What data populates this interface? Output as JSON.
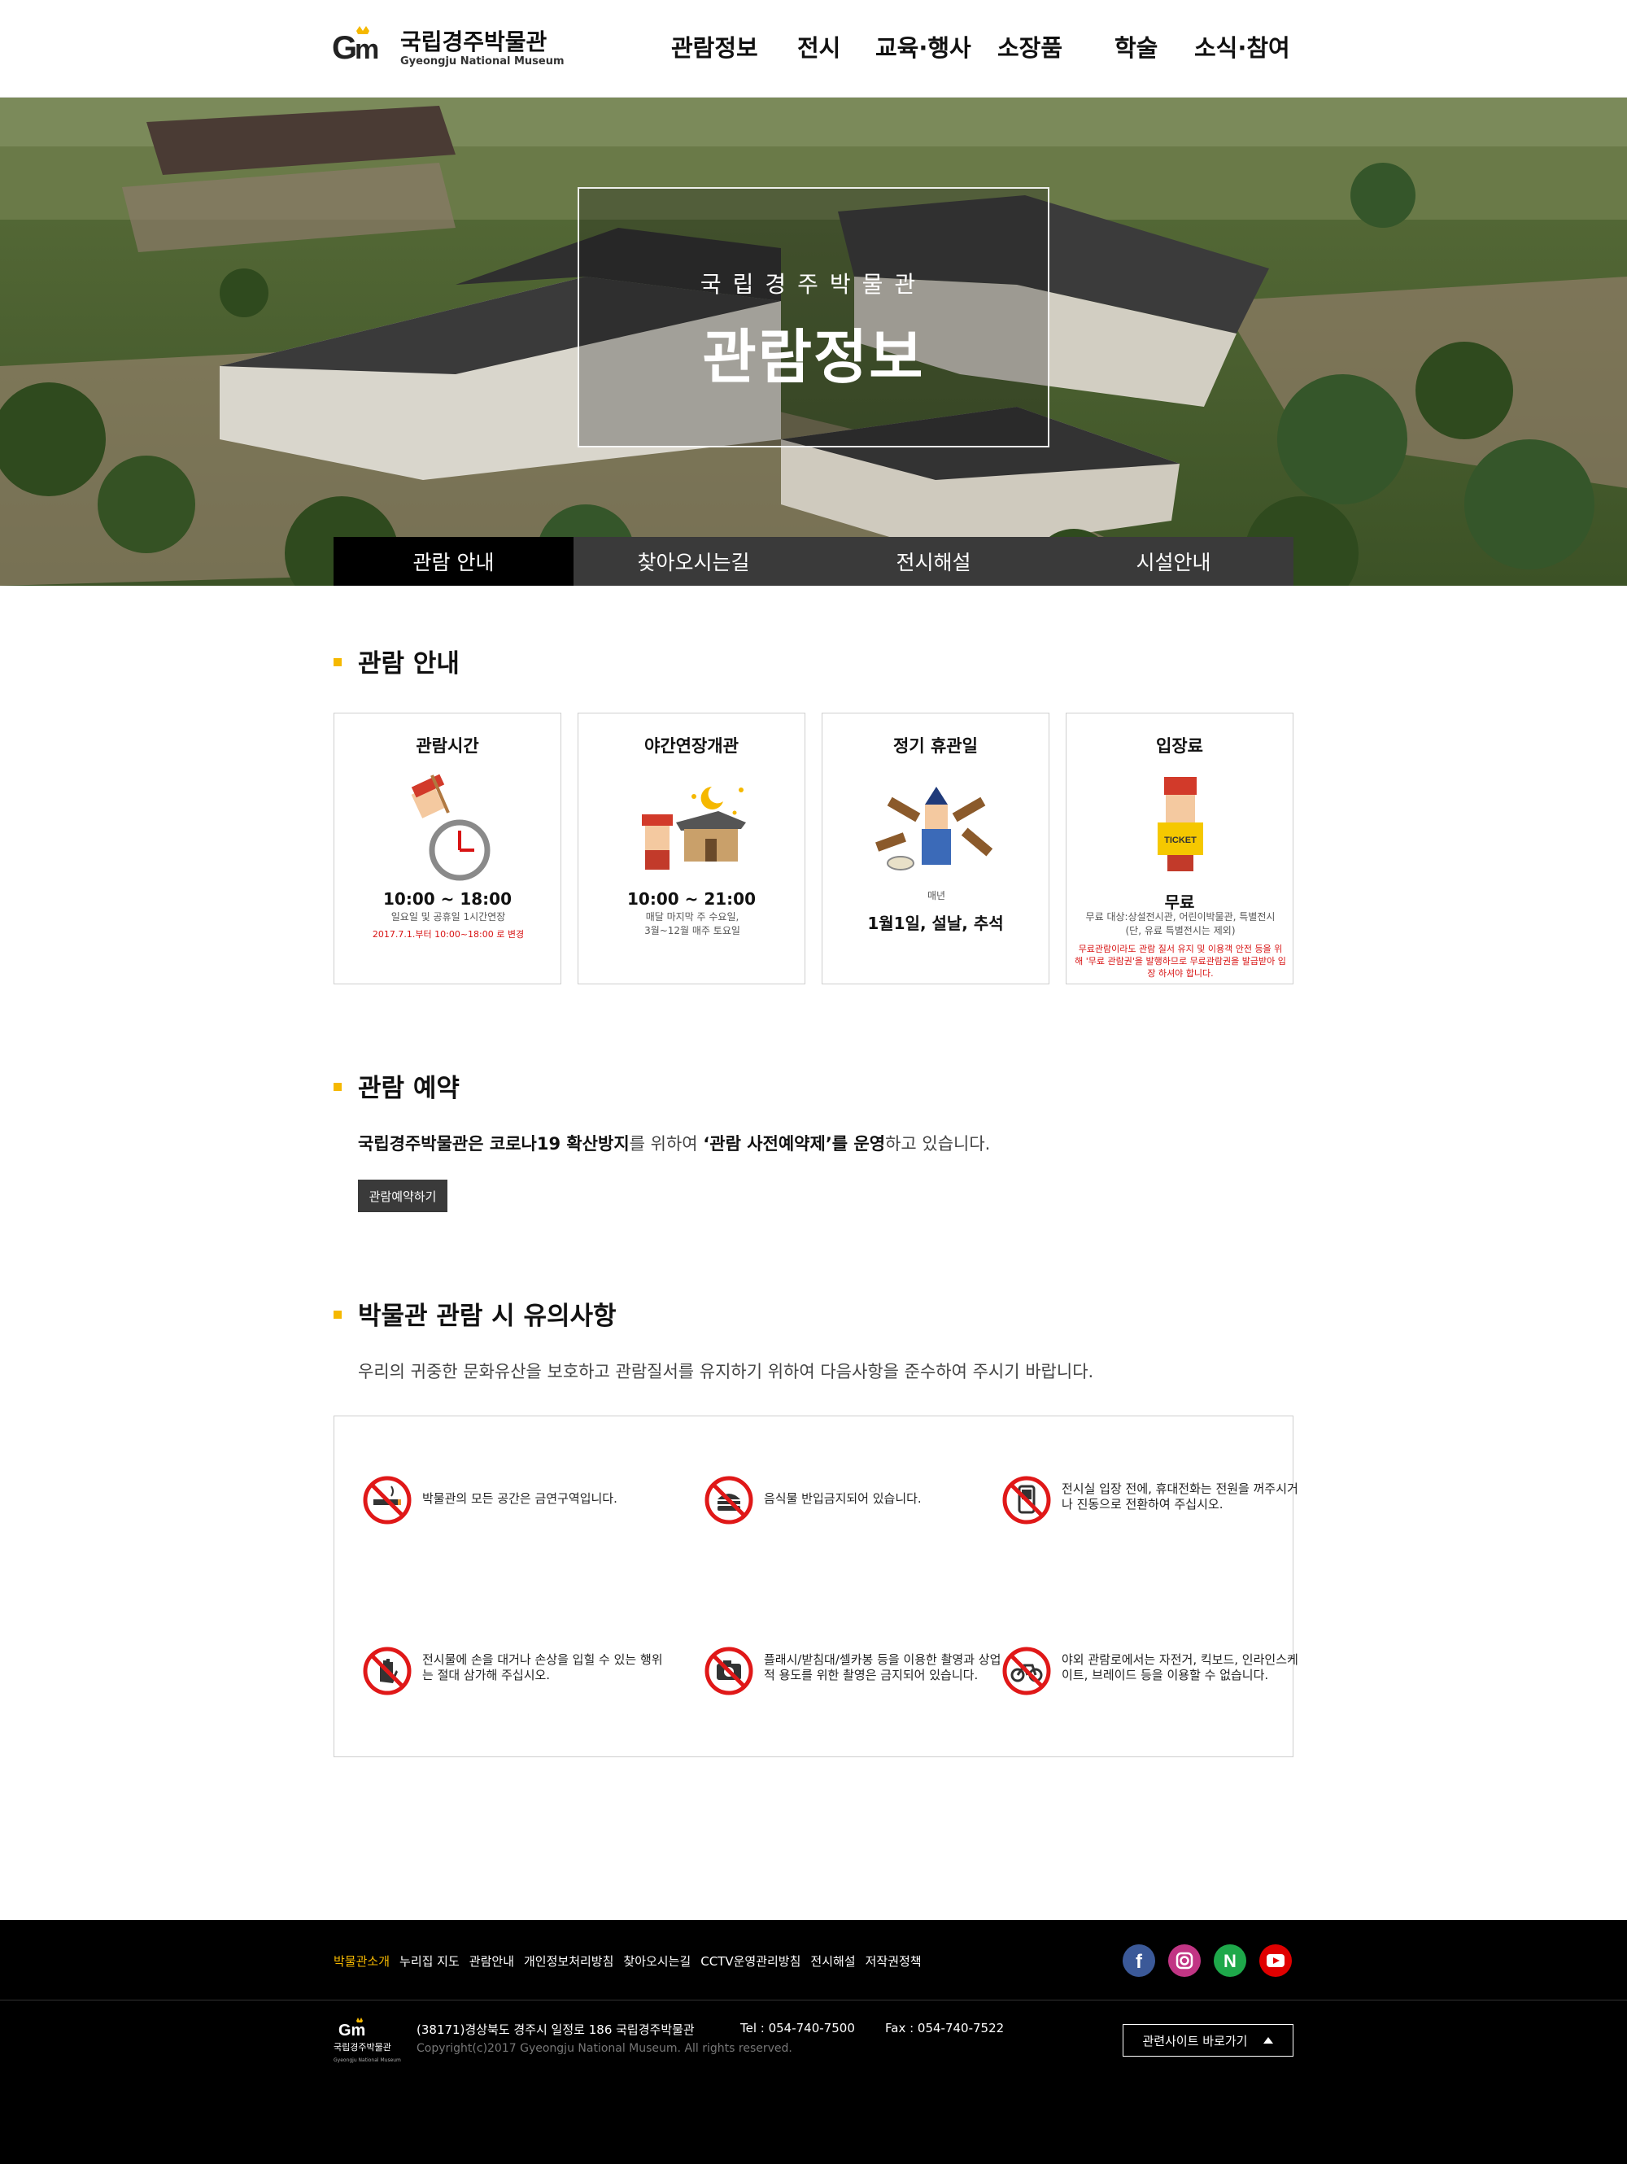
{
  "header": {
    "logo_title": "국립경주박물관",
    "logo_sub": "Gyeongju National Museum",
    "nav": [
      "관람정보",
      "전시",
      "교육·행사",
      "소장품",
      "학술",
      "소식·참여"
    ]
  },
  "hero": {
    "kicker": "국립경주박물관",
    "title": "관람정보"
  },
  "subtabs": [
    "관람 안내",
    "찾아오시는길",
    "전시해설",
    "시설안내"
  ],
  "visit_guide": {
    "title": "관람 안내",
    "cards": [
      {
        "title": "관람시간",
        "main": "10:00 ~ 18:00",
        "sub": "일요일 및 공휴일 1시간연장",
        "note": "2017.7.1.부터 10:00~18:00 로 변경"
      },
      {
        "title": "야간연장개관",
        "main": "10:00 ~ 21:00",
        "sub": "매달 마지막 주 수요일,\n3월~12월 매주 토요일"
      },
      {
        "title": "정기 휴관일",
        "pre": "매년",
        "main": "1월1일, 설날, 추석"
      },
      {
        "title": "입장료",
        "main": "무료",
        "sub": "무료 대상:상설전시관, 어린이박물관, 특별전시\n(단, 유료 특별전시는 제외)",
        "note": "무료관람이라도 관람 질서 유지 및 이용객 안전 등을 위해 '무료 관람권'을 발행하므로 무료관람권을 발급받아 입장 하셔야 합니다.",
        "ticket_label": "TICKET"
      }
    ]
  },
  "reservation": {
    "title": "관람 예약",
    "text_bold1": "국립경주박물관은 코로나19 확산방지",
    "text_mid": "를 위하여 ",
    "text_bold2": "‘관람 사전예약제’를 운영",
    "text_end": "하고 있습니다.",
    "button": "관람예약하기"
  },
  "notices": {
    "title": "박물관 관람 시 유의사항",
    "lead": "우리의 귀중한 문화유산을 보호하고 관람질서를 유지하기 위하여 다음사항을 준수하여 주시기 바랍니다.",
    "items": [
      {
        "icon": "no-smoking-icon",
        "text": "박물관의 모든 공간은 금연구역입니다."
      },
      {
        "icon": "no-food-icon",
        "text": "음식물 반입금지되어 있습니다."
      },
      {
        "icon": "no-phone-icon",
        "text": "전시실 입장 전에, 휴대전화는 전원을 꺼주시거나 진동으로 전환하여 주십시오."
      },
      {
        "icon": "no-touch-icon",
        "text": "전시물에 손을 대거나 손상을 입힐 수 있는 행위는 절대 삼가해 주십시오."
      },
      {
        "icon": "no-camera-icon",
        "text": "플래시/받침대/셀카봉 등을 이용한 촬영과 상업적 용도를 위한 촬영은 금지되어 있습니다."
      },
      {
        "icon": "no-bicycle-icon",
        "text": "야외 관람로에서는 자전거, 킥보드, 인라인스케이트, 브레이드 등을 이용할 수 없습니다."
      }
    ]
  },
  "footer": {
    "nav": [
      "박물관소개",
      "누리집 지도",
      "관람안내",
      "개인정보처리방침",
      "찾아오시는길",
      "CCTV운영관리방침",
      "전시해설",
      "저작권정책"
    ],
    "social": [
      "facebook-icon",
      "instagram-icon",
      "naver-icon",
      "youtube-icon"
    ],
    "logo_title": "국립경주박물관",
    "logo_sub": "Gyeongju National Museum",
    "address": "(38171)경상북도 경주시 일정로 186 국립경주박물관",
    "tel": "Tel : 054-740-7500",
    "fax": "Fax : 054-740-7522",
    "copyright": "Copyright(c)2017 Gyeongju National Museum. All rights reserved.",
    "related_sites": "관련사이트 바로가기"
  },
  "colors": {
    "accent": "#f5b800",
    "alert": "#d81414",
    "dark": "#3a3a3a",
    "footer_bg": "#000000"
  }
}
